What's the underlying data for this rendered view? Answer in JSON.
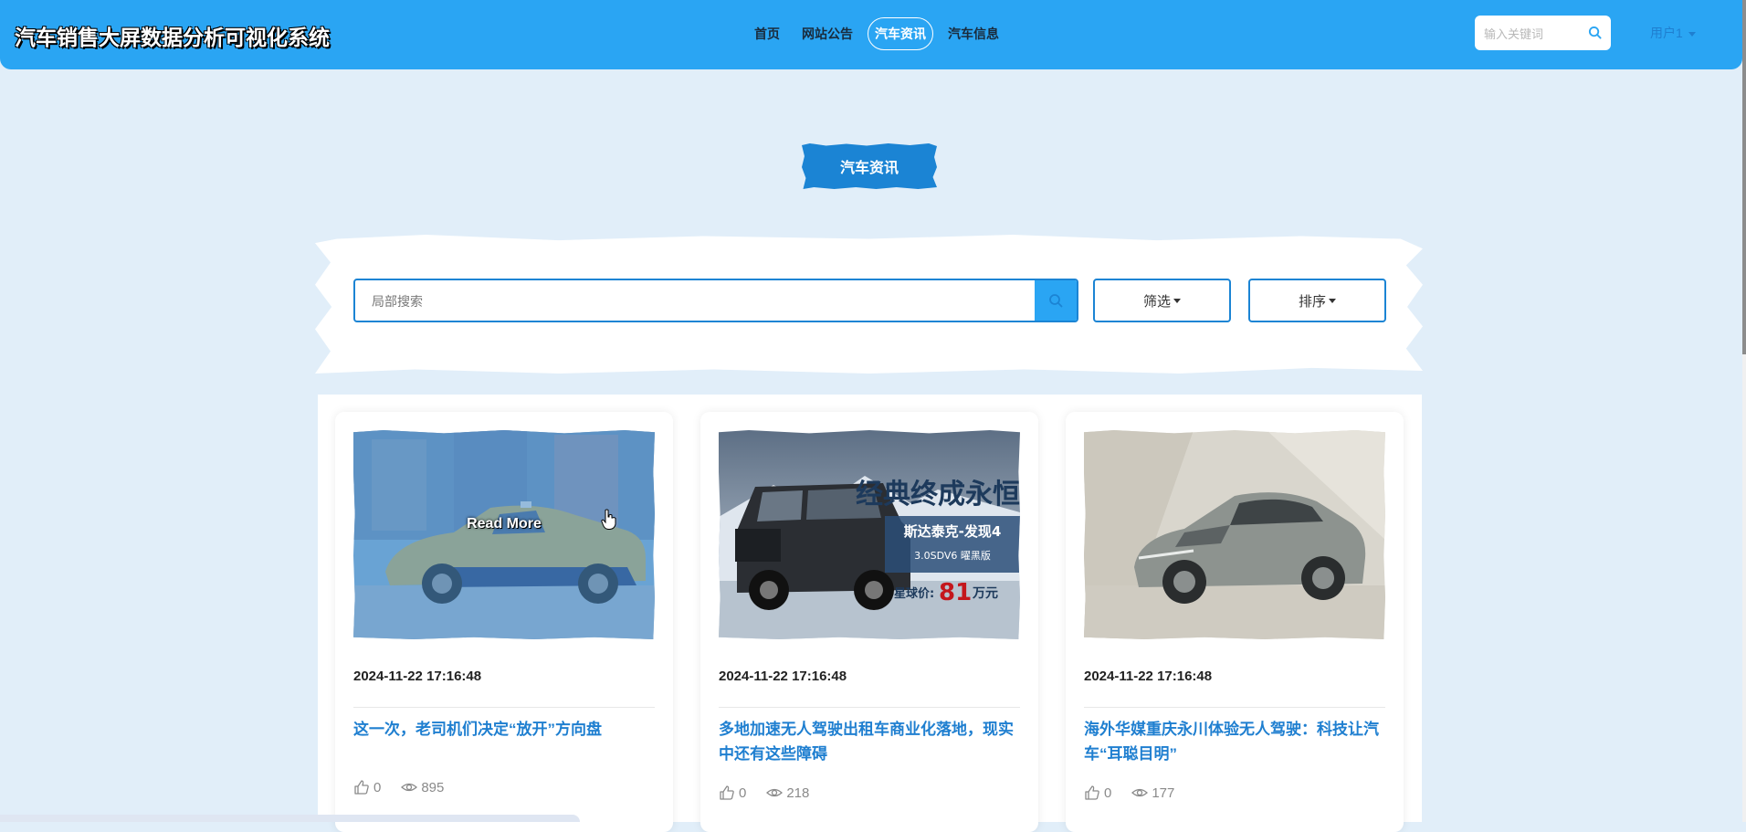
{
  "header": {
    "site_title": "汽车销售大屏数据分析可视化系统",
    "nav": [
      {
        "label": "首页",
        "active": false
      },
      {
        "label": "网站公告",
        "active": false
      },
      {
        "label": "汽车资讯",
        "active": true
      },
      {
        "label": "汽车信息",
        "active": false
      }
    ],
    "search_placeholder": "输入关键词",
    "user_label": "用户1"
  },
  "section": {
    "title": "汽车资讯"
  },
  "search": {
    "placeholder": "局部搜索",
    "filter_label": "筛选",
    "sort_label": "排序"
  },
  "cards": [
    {
      "image": "taxi-photo",
      "overlay_text": "Read More",
      "date": "2024-11-22 17:16:48",
      "title": "这一次，老司机们决定“放开”方向盘",
      "likes": "0",
      "views": "895"
    },
    {
      "image": "suv-ad-banner",
      "banner_headline": "经典终成永恒",
      "banner_model": "斯达泰克-发现4",
      "banner_trim": "3.0SDV6 曜黑版",
      "banner_price_prefix": "星球价:",
      "banner_price": "81",
      "banner_price_unit": "万元",
      "date": "2024-11-22 17:16:48",
      "title": "多地加速无人驾驶出租车商业化落地，现实中还有这些障碍",
      "likes": "0",
      "views": "218"
    },
    {
      "image": "silver-ev-photo",
      "date": "2024-11-22 17:16:48",
      "title": "海外华媒重庆永川体验无人驾驶：科技让汽车“耳聪目明”",
      "likes": "0",
      "views": "177"
    }
  ],
  "colors": {
    "header_bg": "#2aa5f3",
    "accent": "#1b84d4",
    "link": "#1f7fd0",
    "page_bg": "#e1eef9"
  }
}
